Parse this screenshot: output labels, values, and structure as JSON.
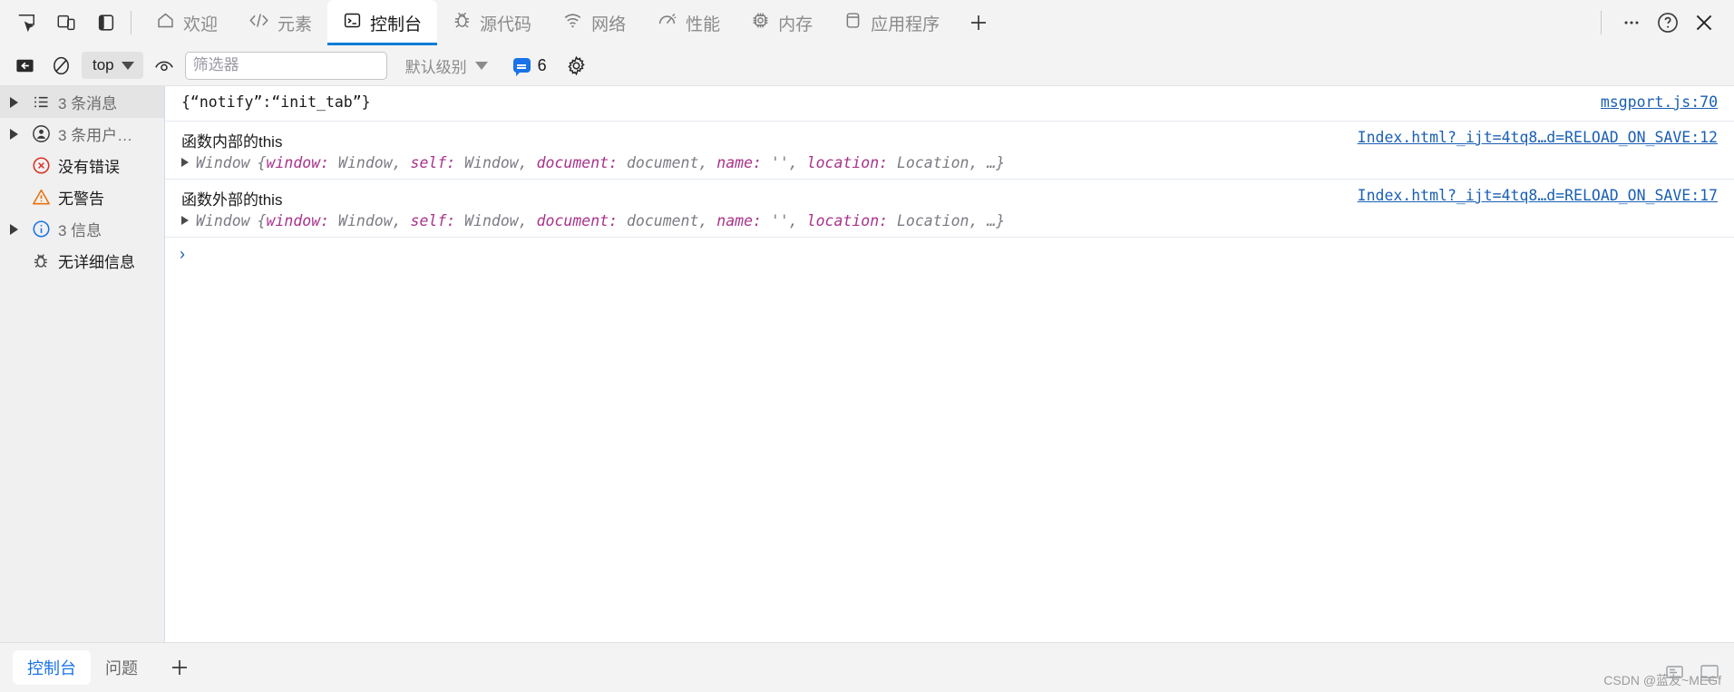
{
  "window": {
    "left_icons": [
      {
        "name": "inspect-element-icon",
        "title": "检查元素"
      },
      {
        "name": "device-toolbar-icon",
        "title": "切换设备工具栏"
      },
      {
        "name": "dock-side-icon",
        "title": "停靠侧边栏"
      }
    ],
    "right_icons": [
      {
        "name": "more-options-icon",
        "glyph": "⋯"
      },
      {
        "name": "help-icon",
        "glyph": "?"
      },
      {
        "name": "close-icon",
        "glyph": "×"
      }
    ]
  },
  "tabs": [
    {
      "id": "welcome",
      "label": "欢迎",
      "icon": "home-icon",
      "selected": false
    },
    {
      "id": "elements",
      "label": "元素",
      "icon": "code-icon",
      "selected": false
    },
    {
      "id": "console",
      "label": "控制台",
      "icon": "console-icon",
      "selected": true
    },
    {
      "id": "sources",
      "label": "源代码",
      "icon": "bug-icon",
      "selected": false
    },
    {
      "id": "network",
      "label": "网络",
      "icon": "wifi-icon",
      "selected": false
    },
    {
      "id": "performance",
      "label": "性能",
      "icon": "speedometer-icon",
      "selected": false
    },
    {
      "id": "memory",
      "label": "内存",
      "icon": "chip-icon",
      "selected": false
    },
    {
      "id": "application",
      "label": "应用程序",
      "icon": "database-icon",
      "selected": false
    }
  ],
  "tab_add_label": "+",
  "console_toolbar": {
    "clear_icon": "clear-console-icon",
    "no_entry_icon": "no-entry-icon",
    "context_value": "top",
    "live_expression_icon": "eye-icon",
    "filter_placeholder": "筛选器",
    "filter_value": "",
    "level_label": "默认级别",
    "issues_count": "6",
    "settings_icon": "gear-icon"
  },
  "sidebar": {
    "items": [
      {
        "id": "messages",
        "label": "3 条消息",
        "icon": "list-icon",
        "arrow": true,
        "selected": true,
        "muted": true
      },
      {
        "id": "user",
        "label": "3 条用户…",
        "icon": "user-icon",
        "arrow": true,
        "selected": false,
        "muted": true
      },
      {
        "id": "errors",
        "label": "没有错误",
        "icon": "error-icon",
        "arrow": false,
        "selected": false,
        "muted": false
      },
      {
        "id": "warnings",
        "label": "无警告",
        "icon": "warning-icon",
        "arrow": false,
        "selected": false,
        "muted": false
      },
      {
        "id": "info",
        "label": "3 信息",
        "icon": "info-icon",
        "arrow": true,
        "selected": false,
        "muted": true
      },
      {
        "id": "verbose",
        "label": "无详细信息",
        "icon": "verbose-icon",
        "arrow": false,
        "selected": false,
        "muted": false
      }
    ]
  },
  "console": {
    "rows": [
      {
        "type": "text",
        "text": "{“notify”:“init_tab”}",
        "source": "msgport.js:70"
      },
      {
        "type": "object",
        "title": "函数内部的this",
        "ctor": "Window",
        "preview_open": "{",
        "preview_pairs": [
          {
            "key": "window:",
            "val": "Window,"
          },
          {
            "key": "self:",
            "val": "Window,"
          },
          {
            "key": "document:",
            "val": "document,"
          },
          {
            "key": "name:",
            "val": "'',"
          },
          {
            "key": "location:",
            "val": "Location,"
          }
        ],
        "preview_ellipsis": "…}",
        "source": "Index.html?_ijt=4tq8…d=RELOAD_ON_SAVE:12"
      },
      {
        "type": "object",
        "title": "函数外部的this",
        "ctor": "Window",
        "preview_open": "{",
        "preview_pairs": [
          {
            "key": "window:",
            "val": "Window,"
          },
          {
            "key": "self:",
            "val": "Window,"
          },
          {
            "key": "document:",
            "val": "document,"
          },
          {
            "key": "name:",
            "val": "'',"
          },
          {
            "key": "location:",
            "val": "Location,"
          }
        ],
        "preview_ellipsis": "…}",
        "source": "Index.html?_ijt=4tq8…d=RELOAD_ON_SAVE:17"
      }
    ],
    "prompt_caret": "›",
    "prompt_value": ""
  },
  "footer": {
    "drawer_tabs": [
      {
        "id": "console",
        "label": "控制台",
        "selected": true
      },
      {
        "id": "issues",
        "label": "问题",
        "selected": false
      }
    ],
    "add_label": "+",
    "right_icons": [
      {
        "name": "screenshot-icon"
      },
      {
        "name": "capture-icon"
      }
    ],
    "watermark": "CSDN @蓝友~MEGf"
  },
  "colors": {
    "accent": "#1a73e8",
    "tab_underline": "#0f7dd8",
    "link": "#1a5fb4",
    "error": "#d93025",
    "warning": "#e8710a",
    "info": "#1a73e8",
    "sidebar_bg": "#f0f0f0",
    "toolbar_bg": "#f3f3f3"
  }
}
